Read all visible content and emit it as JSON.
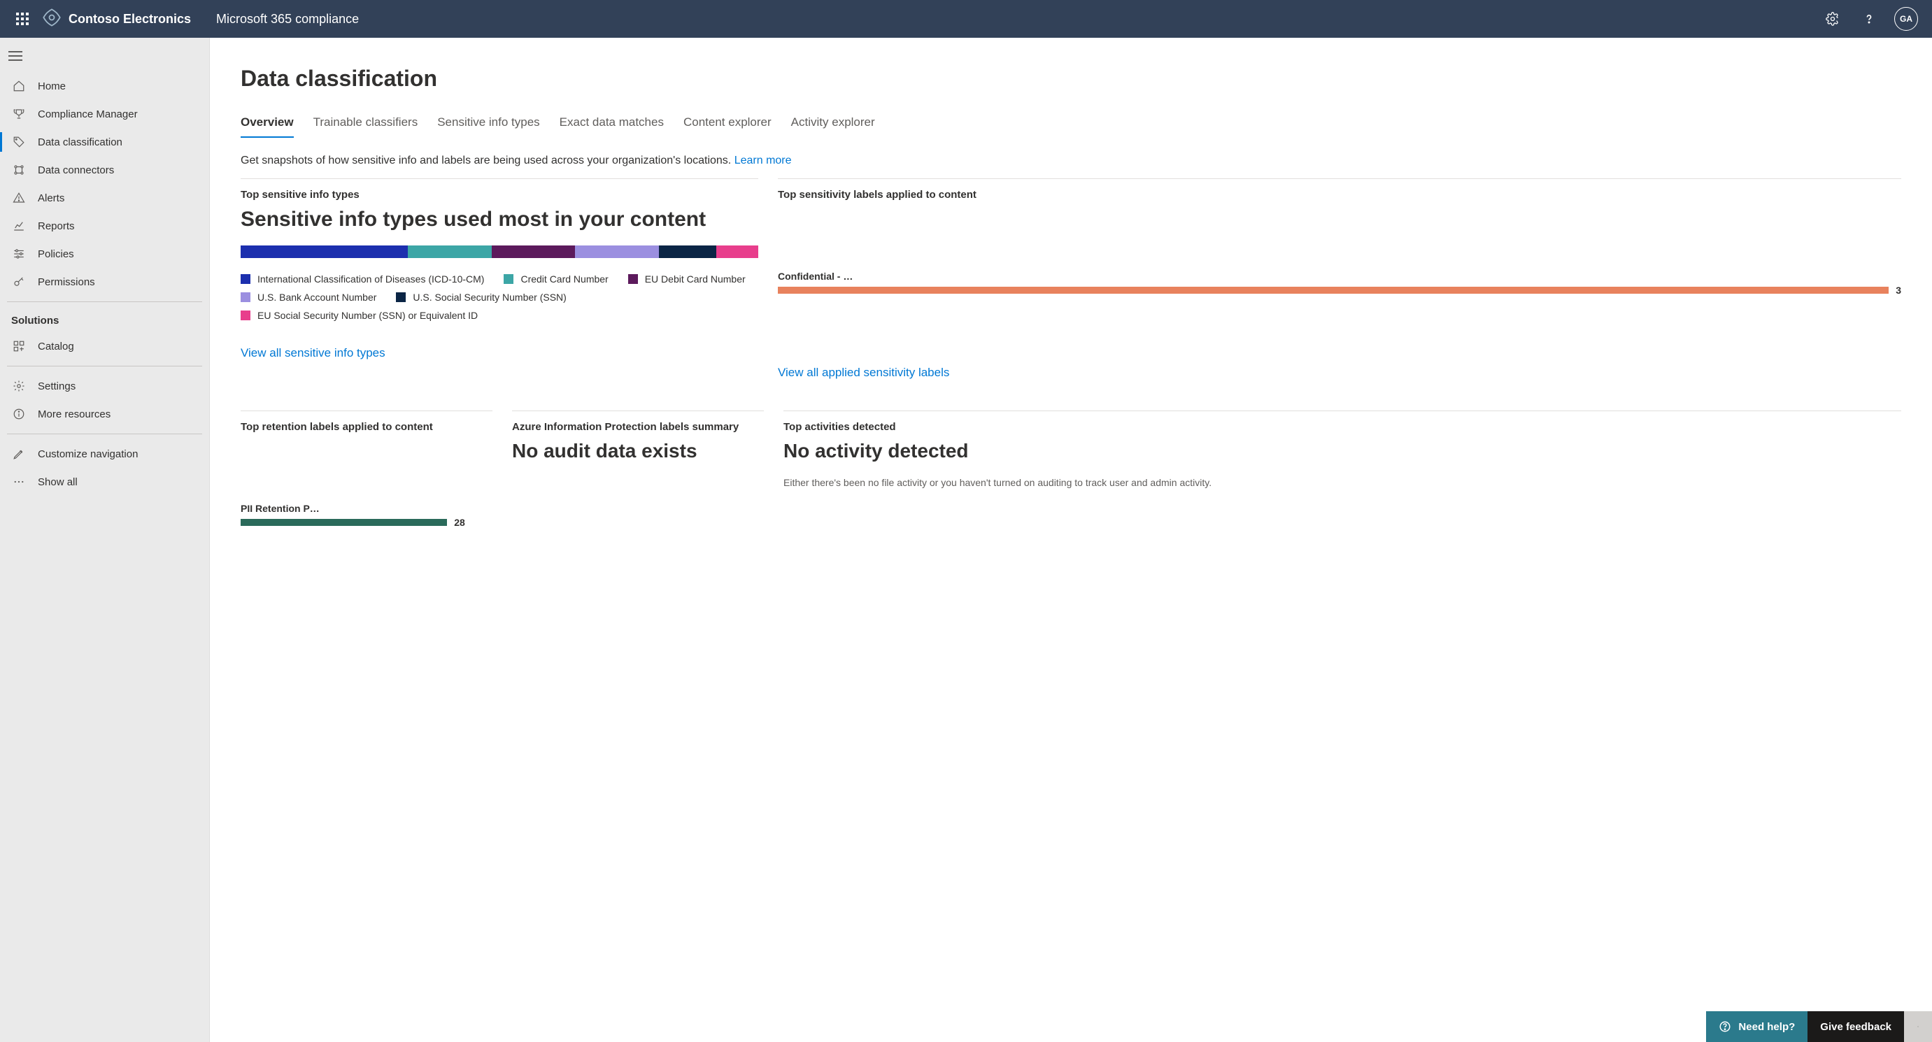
{
  "topbar": {
    "brand": "Contoso Electronics",
    "app": "Microsoft 365 compliance",
    "avatar_initials": "GA"
  },
  "sidebar": {
    "items": [
      {
        "icon": "home",
        "label": "Home"
      },
      {
        "icon": "trophy",
        "label": "Compliance Manager"
      },
      {
        "icon": "tag",
        "label": "Data classification",
        "active": true
      },
      {
        "icon": "connector",
        "label": "Data connectors"
      },
      {
        "icon": "alert",
        "label": "Alerts"
      },
      {
        "icon": "reports",
        "label": "Reports"
      },
      {
        "icon": "sliders",
        "label": "Policies"
      },
      {
        "icon": "key",
        "label": "Permissions"
      }
    ],
    "section_label": "Solutions",
    "catalog": "Catalog",
    "settings": "Settings",
    "more_resources": "More resources",
    "customize": "Customize navigation",
    "show_all": "Show all"
  },
  "page": {
    "title": "Data classification",
    "tabs": [
      "Overview",
      "Trainable classifiers",
      "Sensitive info types",
      "Exact data matches",
      "Content explorer",
      "Activity explorer"
    ],
    "subtext": "Get snapshots of how sensitive info and labels are being used across your organization's locations.",
    "learn_more": "Learn more"
  },
  "card_sit": {
    "title": "Top sensitive info types",
    "heading": "Sensitive info types used most in your content",
    "view_all": "View all sensitive info types"
  },
  "card_labels": {
    "title": "Top sensitivity labels applied to content",
    "row_label": "Confidential - …",
    "row_count": "3",
    "view_all": "View all applied sensitivity labels"
  },
  "card_retention": {
    "title": "Top retention labels applied to content",
    "row_label": "PII Retention P…",
    "row_count": "28"
  },
  "card_aip": {
    "title": "Azure Information Protection labels summary",
    "heading": "No audit data exists"
  },
  "card_activity": {
    "title": "Top activities detected",
    "heading": "No activity detected",
    "sub": "Either there's been no file activity or you haven't turned on auditing to track user and admin activity."
  },
  "footer": {
    "need_help": "Need help?",
    "give_feedback": "Give feedback"
  },
  "chart_data": {
    "type": "bar",
    "title": "Sensitive info types used most in your content",
    "series": [
      {
        "name": "International Classification of Diseases (ICD-10-CM)",
        "color": "#1c2fae",
        "value": 32
      },
      {
        "name": "Credit Card Number",
        "color": "#3ca6a6",
        "value": 16
      },
      {
        "name": "EU Debit Card Number",
        "color": "#5c1a5c",
        "value": 16
      },
      {
        "name": "U.S. Bank Account Number",
        "color": "#9b8fe0",
        "value": 16
      },
      {
        "name": "U.S. Social Security Number (SSN)",
        "color": "#0b2545",
        "value": 11
      },
      {
        "name": "EU Social Security Number (SSN) or Equivalent ID",
        "color": "#e83e8c",
        "value": 8
      }
    ]
  }
}
